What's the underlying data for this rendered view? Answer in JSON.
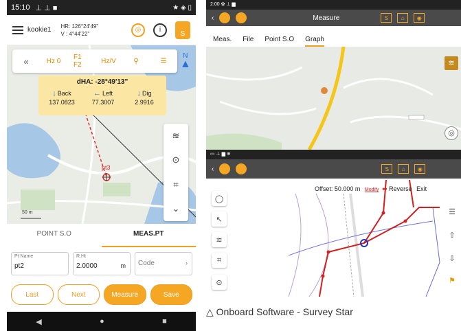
{
  "phone": {
    "status": {
      "time": "15:10",
      "icons": "★ ◈ ▯"
    },
    "header": {
      "user": "kookie1",
      "hr": "HR: 126°24'49\"",
      "v": "V : 4°44'22\"",
      "gps_label": "◎",
      "info_label": "i",
      "avatar_label": "S"
    },
    "tools": {
      "collapse": "«",
      "hz0": "Hz 0",
      "f1f2": "F1 F2",
      "hzv": "Hz/V",
      "target": "⚲",
      "doc": "☰",
      "north": "N"
    },
    "dha": {
      "title": "dHA: -28°49'13\"",
      "back_label": "Back",
      "back_val": "137.0823",
      "left_label": "Left",
      "left_val": "77.3007",
      "dig_label": "Dig",
      "dig_val": "2.9916"
    },
    "map": {
      "point_label": "pt3",
      "scale": "50 m"
    },
    "tabs": {
      "point_so": "POINT S.O",
      "meas_pt": "MEAS.PT"
    },
    "fields": {
      "ptname_label": "Pt Name",
      "ptname_val": "pt2",
      "rht_label": "R.Ht",
      "rht_val": "2.0000",
      "rht_unit": "m",
      "code_placeholder": "Code"
    },
    "buttons": {
      "last": "Last",
      "next": "Next",
      "measure": "Measure",
      "save": "Save"
    }
  },
  "tablet": {
    "status1": "2:00 ✿ ⊥ ▆",
    "title": "Measure",
    "s_label": "S",
    "menu": [
      "Meas.",
      "File",
      "Point S.O",
      "Graph"
    ],
    "status2": "▭ ⊥ ▆ ⊕",
    "offset_text": "Offset: 50.000 m",
    "modify": "Modify",
    "reverse": "Reverse",
    "exit": "Exit"
  },
  "caption": "△ Onboard Software - Survey Star"
}
